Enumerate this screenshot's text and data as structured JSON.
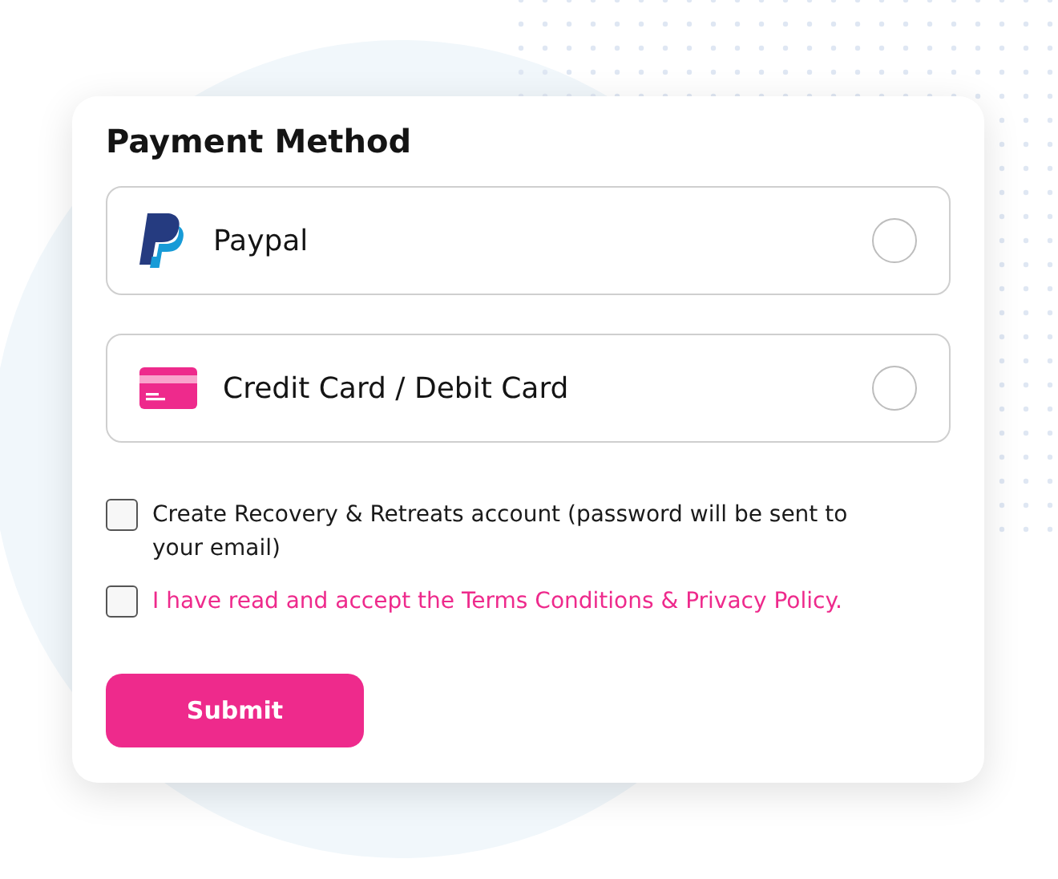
{
  "title": "Payment Method",
  "methods": [
    {
      "kind": "paypal",
      "label": "Paypal",
      "selected": false
    },
    {
      "kind": "card",
      "label": "Credit Card / Debit Card",
      "selected": false
    }
  ],
  "agreements": [
    {
      "label": "Create Recovery & Retreats account (password will be sent to your email)",
      "checked": false,
      "link": false
    },
    {
      "label": "I have read and accept the Terms Conditions & Privacy Policy.",
      "checked": false,
      "link": true
    }
  ],
  "submit": "Submit"
}
